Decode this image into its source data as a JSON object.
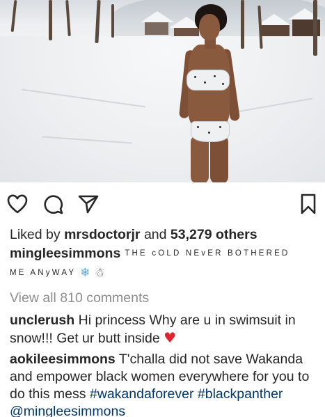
{
  "post": {
    "likes": {
      "prefix": "Liked by",
      "first_user": "mrsdoctorjr",
      "conj": "and",
      "others": "53,279 others"
    },
    "caption": {
      "username": "mingleesimmons",
      "line1": "THE cOLD NEvER BOTHERED",
      "line2": "ME ANyWAY",
      "emoji1": "❄",
      "emoji2": "☃"
    },
    "view_all": "View all 810 comments",
    "comments": [
      {
        "username": "unclerush",
        "text": "Hi princess  Why are u in swimsuit in snow!!! Get ur butt inside",
        "emoji": "♥"
      },
      {
        "username": "aokileesimmons",
        "text": "T'challa did not save Wakanda and empower black women everywhere for you to do this mess",
        "hashtag1": "#wakandaforever",
        "hashtag2": "#blackpanther",
        "mention": "@mingleesimmons"
      }
    ]
  },
  "icons": {
    "like": "heart-outline-icon",
    "comment": "speech-bubble-icon",
    "share": "paper-plane-icon",
    "save": "bookmark-icon"
  },
  "colors": {
    "text": "#262626",
    "muted": "#8e8e8e",
    "link": "#003569",
    "heart": "#e0242f"
  }
}
